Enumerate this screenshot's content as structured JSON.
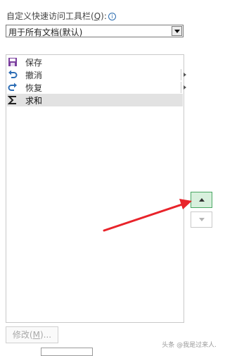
{
  "heading": {
    "text_before": "自定义快速访问工具栏(",
    "hotkey": "Q",
    "text_after": "):",
    "info_glyph": "i"
  },
  "scope_select": {
    "selected": "用于所有文档(默认)"
  },
  "commands": [
    {
      "label": "保存",
      "icon": "save-icon",
      "submenu": false,
      "selected": false
    },
    {
      "label": "撤消",
      "icon": "undo-icon",
      "submenu": true,
      "selected": false
    },
    {
      "label": "恢复",
      "icon": "redo-icon",
      "submenu": true,
      "selected": false
    },
    {
      "label": "求和",
      "icon": "sum-icon",
      "submenu": false,
      "selected": true
    }
  ],
  "move_up": {
    "icon": "triangle-up-icon"
  },
  "move_down": {
    "icon": "triangle-down-icon"
  },
  "modify_button": {
    "text_before": "修改(",
    "hotkey": "M",
    "text_after": ")..."
  },
  "watermark": "头条 @我是过来人.",
  "colors": {
    "annotation_arrow": "#e8232a",
    "selection": "#e2e2e2",
    "highlight_button": "#d8f0dd"
  }
}
